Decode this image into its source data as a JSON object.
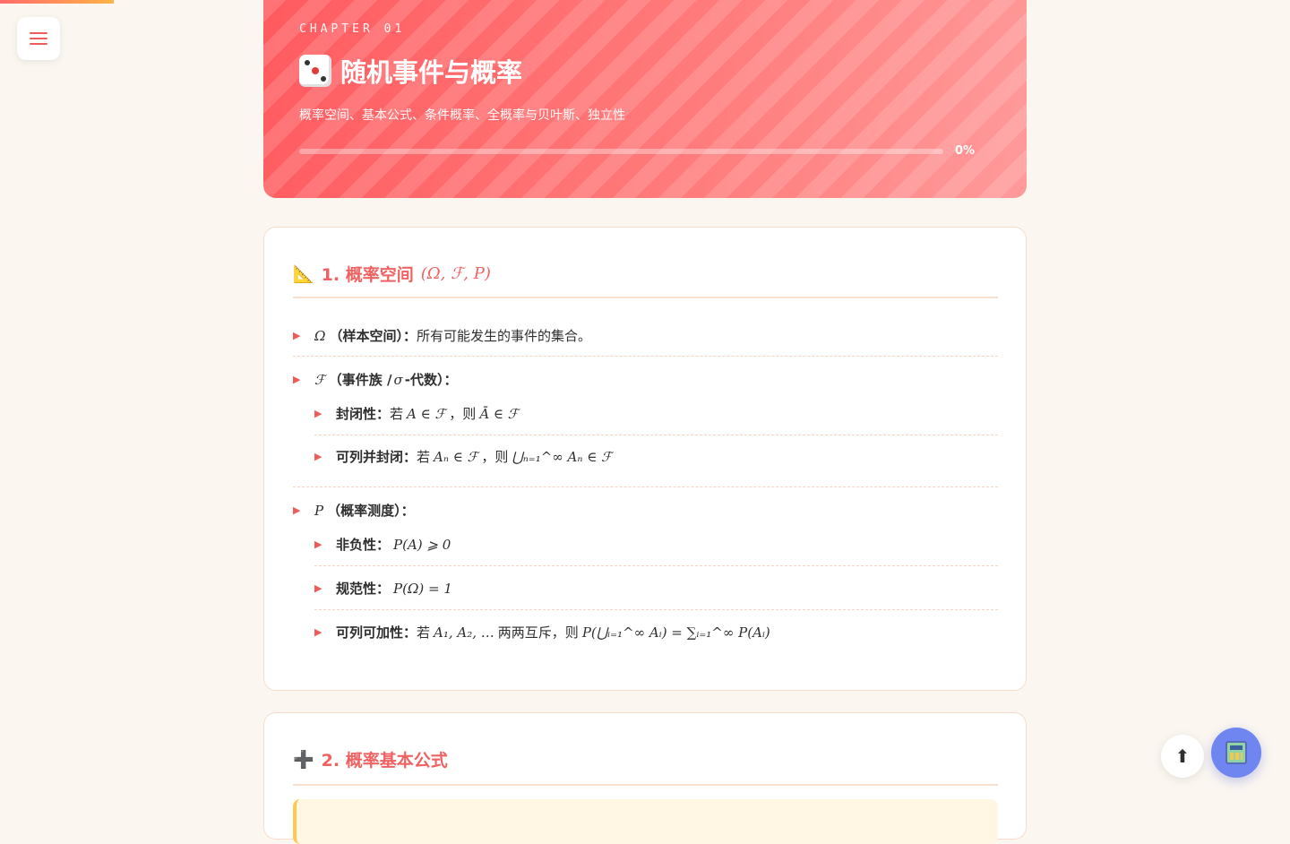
{
  "hero": {
    "kicker": "CHAPTER 01",
    "emoji": "🎲",
    "title": "随机事件与概率",
    "subtitle": "概率空间、基本公式、条件概率、全概率与贝叶斯、独立性",
    "progress_value": 0,
    "progress_label": "0%"
  },
  "section1": {
    "emoji": "📐",
    "title": "1. 概率空间",
    "title_math": "(Ω, ℱ, P)",
    "items": [
      {
        "symbol": "Ω",
        "label": "（样本空间）：",
        "text": "所有可能发生的事件的集合。"
      },
      {
        "symbol": "ℱ",
        "label": "（事件族 / ",
        "label_math": "σ",
        "label_tail": "-代数）：",
        "sub": [
          {
            "label": "封闭性：",
            "t1": "若",
            "m1": "A ∈ ℱ",
            "t2": "，则",
            "m2": "Ā ∈ ℱ"
          },
          {
            "label": "可列并封闭：",
            "t1": "若",
            "m1": "Aₙ ∈ ℱ",
            "t2": "，则",
            "m2": "⋃ₙ₌₁^∞ Aₙ ∈ ℱ"
          }
        ]
      },
      {
        "symbol": "P",
        "label": "（概率测度）：",
        "sub": [
          {
            "label": "非负性：",
            "m1": "P(A) ⩾ 0"
          },
          {
            "label": "规范性：",
            "m1": "P(Ω) = 1"
          },
          {
            "label": "可列可加性：",
            "t1": "若",
            "m1": "A₁, A₂, …",
            "t2": "两两互斥，则",
            "m2": "P(⋃ᵢ₌₁^∞ Aᵢ) = ∑ᵢ₌₁^∞ P(Aᵢ)"
          }
        ]
      }
    ]
  },
  "section2": {
    "emoji": "➕",
    "title": "2. 概率基本公式"
  },
  "buttons": {
    "back_to_top": "⬆"
  },
  "colors": {
    "accent": "#f06262",
    "hero_start": "#ff5b5f",
    "hero_end": "#ff9a9a",
    "fab": "#6f86f0",
    "tip": "#fff6e4"
  }
}
